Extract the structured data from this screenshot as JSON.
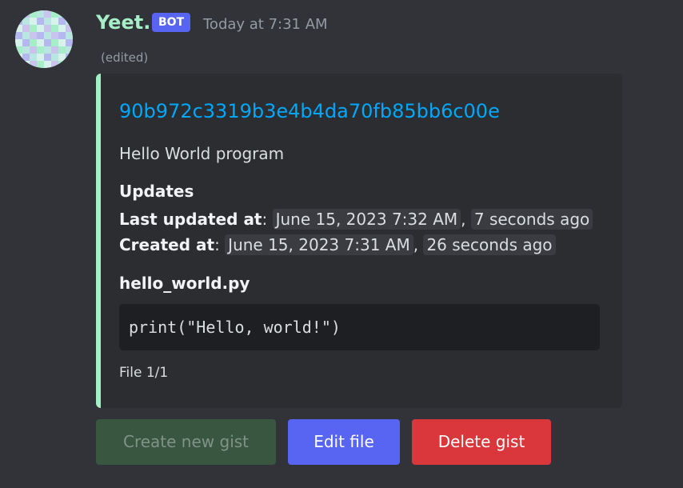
{
  "author": {
    "username": "Yeet.",
    "tag": "BOT",
    "timestamp": "Today at 7:31 AM",
    "edited": "(edited)",
    "avatar_colors": [
      "#b9e6e0",
      "#c8c4ee",
      "#a6eec8",
      "#d6f2ea",
      "#b4b8ee"
    ]
  },
  "embed": {
    "accent_color": "#a6eec8",
    "title": "90b972c3319b3e4b4da70fb85bb6c00e",
    "description": "Hello World program",
    "updates_heading": "Updates",
    "last_updated": {
      "label": "Last updated at",
      "date": "June 15, 2023 7:32 AM",
      "relative": "7 seconds ago"
    },
    "created": {
      "label": "Created at",
      "date": "June 15, 2023 7:31 AM",
      "relative": "26 seconds ago"
    },
    "file_name": "hello_world.py",
    "code": "print(\"Hello, world!\")",
    "footer": "File 1/1"
  },
  "buttons": {
    "create": "Create new gist",
    "edit": "Edit file",
    "delete": "Delete gist"
  }
}
